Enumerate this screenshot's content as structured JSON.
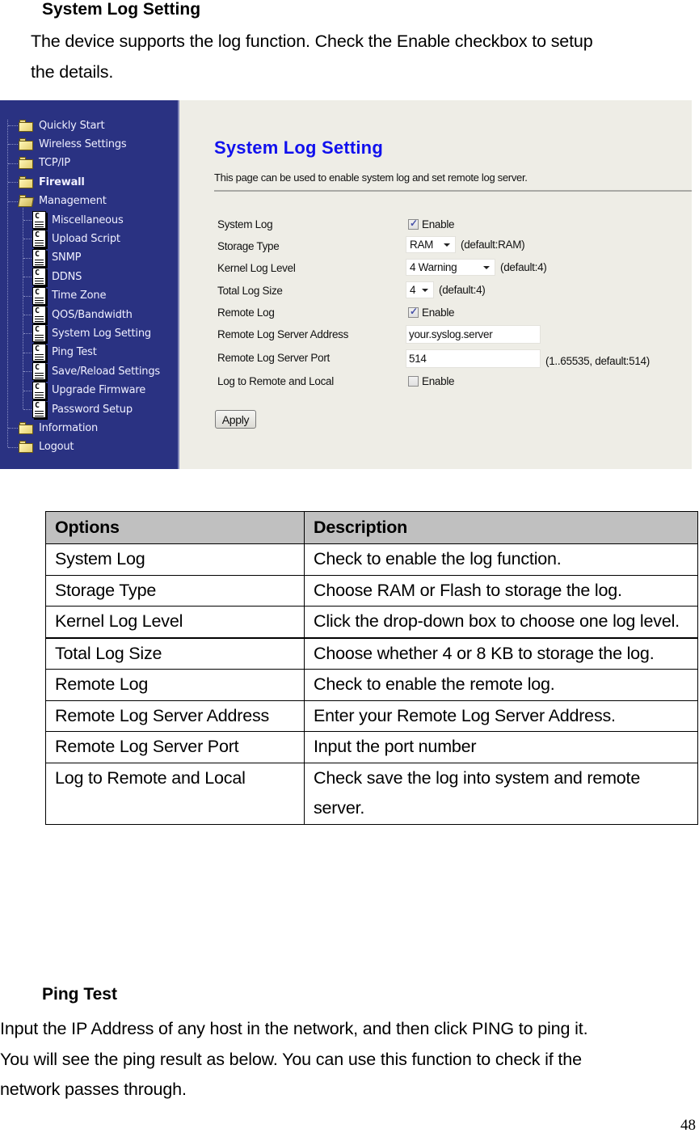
{
  "section1": {
    "heading": "System Log Setting",
    "paragraph_lines": [
      "The device supports the log function. Check the Enable checkbox to setup",
      "the details."
    ]
  },
  "screenshot": {
    "nav": {
      "items": [
        {
          "label": "Quickly Start",
          "type": "folder",
          "level": 0,
          "bold": false
        },
        {
          "label": "Wireless Settings",
          "type": "folder",
          "level": 0,
          "bold": false
        },
        {
          "label": "TCP/IP",
          "type": "folder",
          "level": 0,
          "bold": false
        },
        {
          "label": "Firewall",
          "type": "folder",
          "level": 0,
          "bold": true
        },
        {
          "label": "Management",
          "type": "folder-open",
          "level": 0,
          "bold": false
        },
        {
          "label": "Miscellaneous",
          "type": "page",
          "level": 1,
          "bold": false
        },
        {
          "label": "Upload Script",
          "type": "page",
          "level": 1,
          "bold": false
        },
        {
          "label": "SNMP",
          "type": "page",
          "level": 1,
          "bold": false
        },
        {
          "label": "DDNS",
          "type": "page",
          "level": 1,
          "bold": false
        },
        {
          "label": "Time Zone",
          "type": "page",
          "level": 1,
          "bold": false
        },
        {
          "label": "QOS/Bandwidth",
          "type": "page",
          "level": 1,
          "bold": false
        },
        {
          "label": "System Log Setting",
          "type": "page",
          "level": 1,
          "bold": false
        },
        {
          "label": "Ping Test",
          "type": "page",
          "level": 1,
          "bold": false
        },
        {
          "label": "Save/Reload Settings",
          "type": "page",
          "level": 1,
          "bold": false
        },
        {
          "label": "Upgrade Firmware",
          "type": "page",
          "level": 1,
          "bold": false
        },
        {
          "label": "Password Setup",
          "type": "page",
          "level": 1,
          "bold": false
        },
        {
          "label": "Information",
          "type": "folder",
          "level": 0,
          "bold": false
        },
        {
          "label": "Logout",
          "type": "folder",
          "level": 0,
          "bold": false
        }
      ]
    },
    "title": "System Log Setting",
    "description": "This page can be used to enable system log and set remote log server.",
    "form": {
      "system_log": {
        "label": "System Log",
        "checkbox_label": "Enable",
        "checked": true
      },
      "storage_type": {
        "label": "Storage Type",
        "value": "RAM",
        "hint": "(default:RAM)"
      },
      "kernel_log_level": {
        "label": "Kernel Log Level",
        "value": "4 Warning",
        "hint": "(default:4)"
      },
      "total_log_size": {
        "label": "Total Log Size",
        "value": "4",
        "hint": "(default:4)"
      },
      "remote_log": {
        "label": "Remote Log",
        "checkbox_label": "Enable",
        "checked": true
      },
      "remote_server_address": {
        "label": "Remote Log Server Address",
        "value": "your.syslog.server"
      },
      "remote_server_port": {
        "label": "Remote Log Server Port",
        "value": "514",
        "hint": "(1..65535, default:514)"
      },
      "log_remote_local": {
        "label": "Log to Remote and Local",
        "checkbox_label": "Enable",
        "checked": false
      },
      "apply_label": "Apply"
    },
    "colors": {
      "nav_bg": "#2a3282",
      "content_bg": "#eeede6",
      "title": "#1010ee"
    }
  },
  "options_table": {
    "headers": [
      "Options",
      "Description"
    ],
    "rows": [
      {
        "option": "System Log",
        "description": "Check to enable the log function."
      },
      {
        "option": "Storage Type",
        "description": "Choose RAM or Flash to storage the log."
      },
      {
        "option": "Kernel Log Level",
        "description": "Click the drop-down box to choose one log level."
      },
      {
        "option": "Total Log Size",
        "description": "Choose whether 4 or 8 KB to storage the log."
      },
      {
        "option": "Remote Log",
        "description": "Check to enable the remote log."
      },
      {
        "option": "Remote Log Server Address",
        "description": "Enter your Remote Log Server Address."
      },
      {
        "option": "Remote Log Server Port",
        "description": "Input the port number"
      },
      {
        "option": "Log to Remote and Local",
        "description": "Check save the log into system and remote server."
      }
    ]
  },
  "section2": {
    "heading": "Ping Test",
    "paragraph_lines": [
      "Input the IP Address of any host in the network, and then click PING to ping it.",
      "You will see the ping result as below. You can use this function to check if the",
      "network passes through."
    ]
  },
  "page_number": "48"
}
